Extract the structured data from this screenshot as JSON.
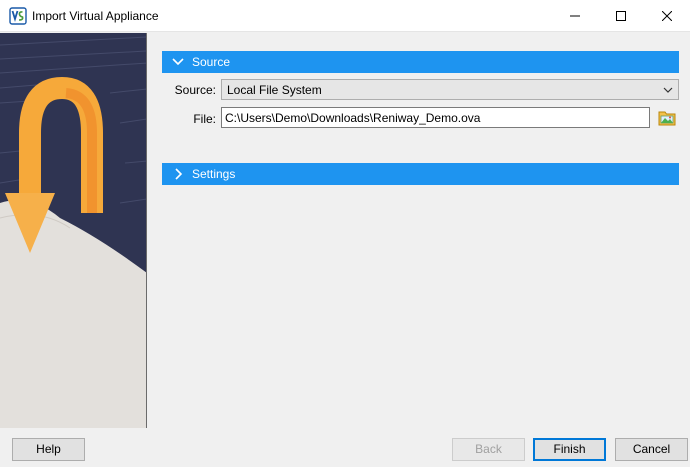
{
  "window": {
    "title": "Import Virtual Appliance",
    "icon": "virtualbox-icon"
  },
  "sections": {
    "source": {
      "header": "Source",
      "expanded": true,
      "source_label": "Source:",
      "source_value": "Local File System",
      "file_label": "File:",
      "file_value": "C:\\Users\\Demo\\Downloads\\Reniway_Demo.ova"
    },
    "settings": {
      "header": "Settings",
      "expanded": false
    }
  },
  "buttons": {
    "help": "Help",
    "back": "Back",
    "finish": "Finish",
    "cancel": "Cancel"
  },
  "colors": {
    "section_header": "#1e94f0",
    "finish_border": "#0078d7"
  }
}
